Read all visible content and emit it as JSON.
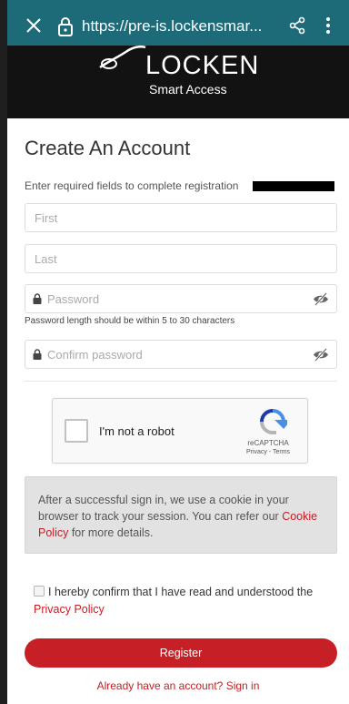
{
  "browser": {
    "url": "https://pre-is.lockensmar..."
  },
  "header": {
    "logo_text": "LOCKEN",
    "logo_sub": "Smart Access"
  },
  "form": {
    "title": "Create An Account",
    "intro": "Enter required fields to complete registration",
    "first_placeholder": "First",
    "last_placeholder": "Last",
    "password_placeholder": "Password",
    "password_hint": "Password length should be within 5 to 30 characters",
    "confirm_placeholder": "Confirm password"
  },
  "recaptcha": {
    "label": "I'm not a robot",
    "brand": "reCAPTCHA",
    "terms": "Privacy - Terms"
  },
  "cookie": {
    "text_before": "After a successful sign in, we use a cookie in your browser to track your session. You can refer our ",
    "link": "Cookie Policy",
    "text_after": " for more details."
  },
  "confirm": {
    "text": "I hereby confirm that I have read and understood the ",
    "link": "Privacy Policy"
  },
  "register_label": "Register",
  "signin_label": "Already have an account? Sign in",
  "colors": {
    "browser_bar": "#1d6b78",
    "banner": "#121212",
    "accent_red": "#c62026",
    "cookie_box": "#e2e2e2"
  }
}
